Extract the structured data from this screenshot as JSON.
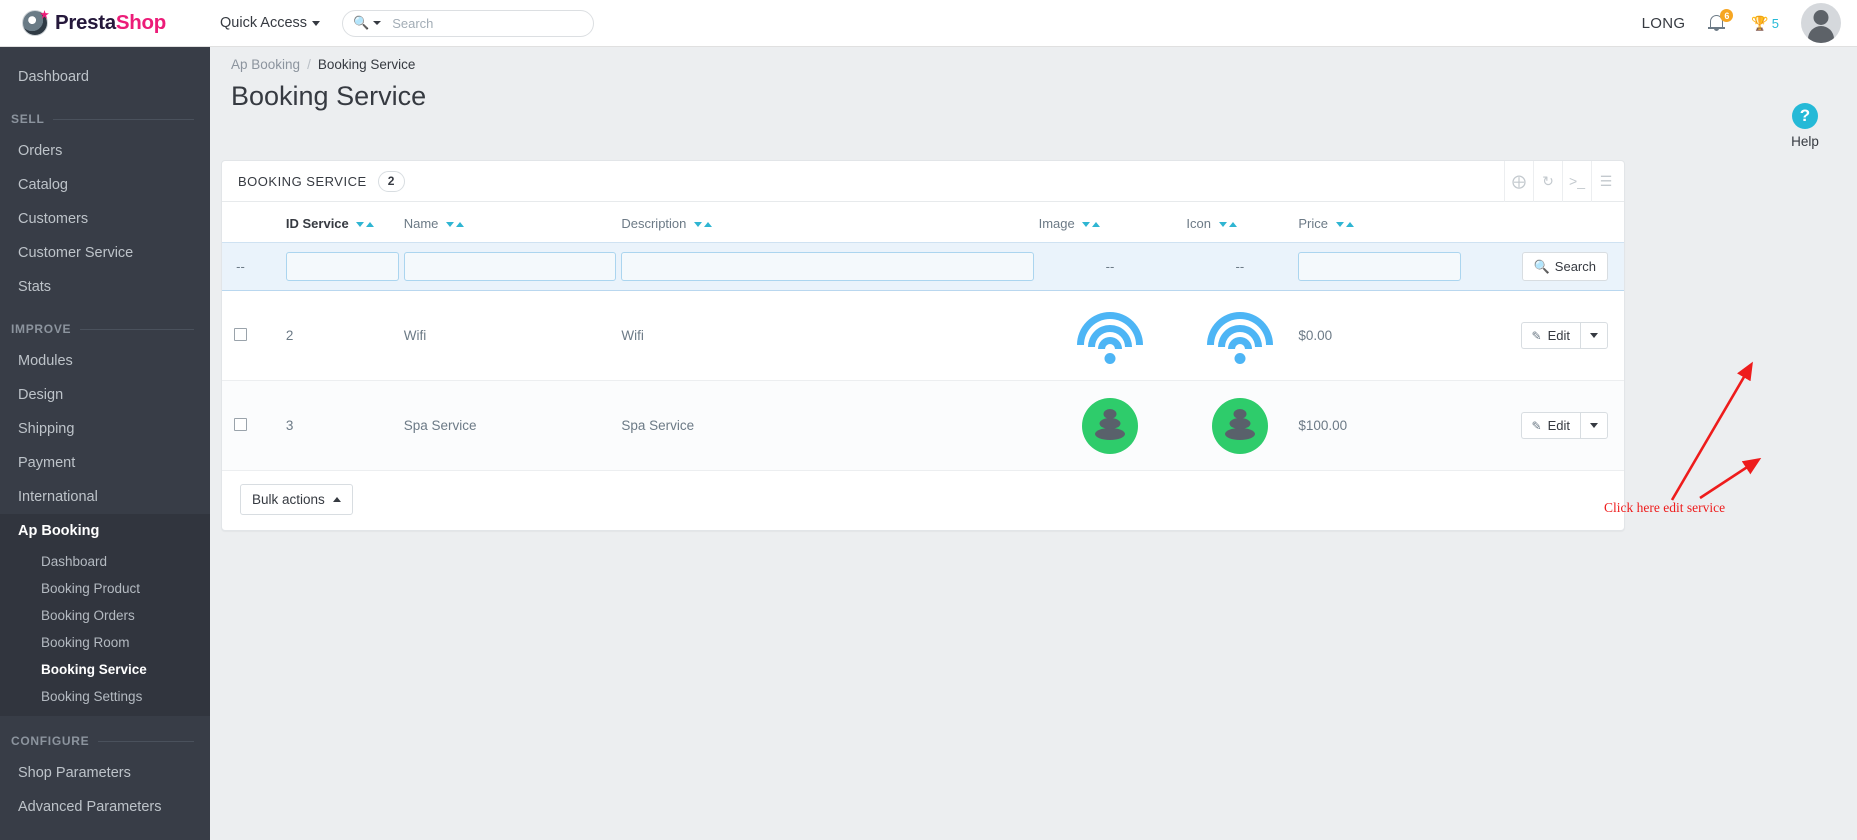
{
  "topbar": {
    "brand_presta": "Presta",
    "brand_shop": "Shop",
    "quick_access_label": "Quick Access",
    "search_placeholder": "Search",
    "search_value": "",
    "user_name": "LONG",
    "notification_count": "6",
    "trophy_count": "5"
  },
  "sidebar": {
    "items": [
      {
        "label": "Dashboard",
        "type": "item"
      }
    ],
    "sections": [
      {
        "title": "SELL",
        "items": [
          "Orders",
          "Catalog",
          "Customers",
          "Customer Service",
          "Stats"
        ]
      },
      {
        "title": "IMPROVE",
        "items": [
          "Modules",
          "Design",
          "Shipping",
          "Payment",
          "International"
        ]
      }
    ],
    "active_group": {
      "parent": "Ap Booking",
      "children": [
        "Dashboard",
        "Booking Product",
        "Booking Orders",
        "Booking Room",
        "Booking Service",
        "Booking Settings"
      ],
      "active_child": "Booking Service"
    },
    "configure": {
      "title": "CONFIGURE",
      "items": [
        "Shop Parameters",
        "Advanced Parameters"
      ]
    }
  },
  "header": {
    "breadcrumb_parent": "Ap Booking",
    "breadcrumb_sep": "/",
    "breadcrumb_current": "Booking Service",
    "page_title": "Booking Service",
    "help_label": "Help",
    "help_glyph": "?"
  },
  "panel": {
    "title": "BOOKING SERVICE",
    "count": "2",
    "tools": [
      "add-icon",
      "refresh-icon",
      "terminal-icon",
      "export-icon"
    ]
  },
  "table": {
    "columns": [
      {
        "label": "ID Service",
        "sortable": true,
        "active": true
      },
      {
        "label": "Name",
        "sortable": true,
        "active": false
      },
      {
        "label": "Description",
        "sortable": true,
        "active": false
      },
      {
        "label": "Image",
        "sortable": true,
        "active": false
      },
      {
        "label": "Icon",
        "sortable": true,
        "active": false
      },
      {
        "label": "Price",
        "sortable": true,
        "active": false
      }
    ],
    "filters": {
      "id_placeholder": "",
      "id_value": "",
      "name_placeholder": "",
      "name_value": "",
      "description_placeholder": "",
      "description_value": "",
      "image_value": "--",
      "icon_value": "--",
      "price_placeholder": "",
      "price_value": "",
      "checkbox_value": "--",
      "search_label": "Search"
    },
    "rows": [
      {
        "id": "2",
        "name": "Wifi",
        "description": "Wifi",
        "image": "wifi-icon",
        "icon": "wifi-icon",
        "price": "$0.00",
        "edit_label": "Edit"
      },
      {
        "id": "3",
        "name": "Spa Service",
        "description": "Spa Service",
        "image": "spa-stones-icon",
        "icon": "spa-stones-icon",
        "price": "$100.00",
        "edit_label": "Edit"
      }
    ]
  },
  "footer": {
    "bulk_actions_label": "Bulk actions"
  },
  "annotation": {
    "text": "Click here edit service",
    "color": "#ee1c1c"
  }
}
